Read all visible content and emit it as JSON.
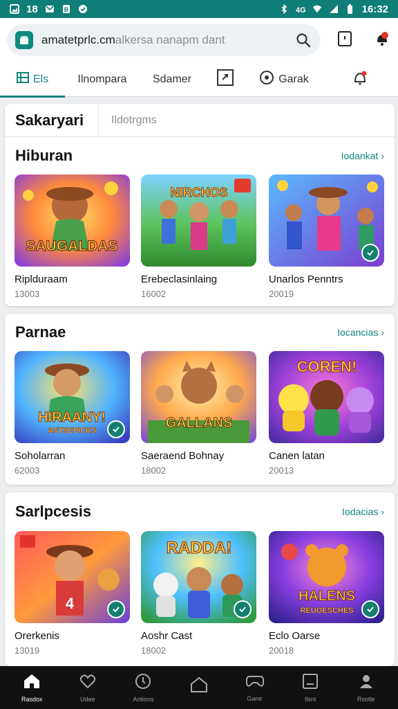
{
  "status_bar": {
    "time_left": "18",
    "time_right": "16:32"
  },
  "browser": {
    "url_main": "amatetprlc.cm",
    "url_rest": "alkersa nanapm dant"
  },
  "tabs": [
    {
      "label": "Els"
    },
    {
      "label": "Ilnompara"
    },
    {
      "label": "Sdamer"
    },
    {
      "label": ""
    },
    {
      "label": "Garak"
    },
    {
      "label": ""
    }
  ],
  "category_tabs": {
    "active": "Sakaryari",
    "inactive": "Ildotrgms"
  },
  "sections": [
    {
      "title": "Hiburan",
      "more": "Iodankat",
      "games": [
        {
          "name": "Riplduraam",
          "count": "13003",
          "art_text": "SAUGALDAS"
        },
        {
          "name": "Erebeclasinlaing",
          "count": "16002",
          "art_text": "NIRCHOS"
        },
        {
          "name": "Unarlos Penntrs",
          "count": "20019",
          "art_text": ""
        }
      ]
    },
    {
      "title": "Parnae",
      "more": "Iocancias",
      "games": [
        {
          "name": "Soholarran",
          "count": "62003",
          "art_text": "HIRAANY!",
          "art_sub": "ANTSEPICKS"
        },
        {
          "name": "Saeraend Bohnay",
          "count": "18002",
          "art_text": "GALLANS"
        },
        {
          "name": "Canen latan",
          "count": "20013",
          "art_text": "COREN!"
        }
      ]
    },
    {
      "title": "Sarlpcesis",
      "more": "Iodacias",
      "games": [
        {
          "name": "Orerkenis",
          "count": "13019",
          "art_text": ""
        },
        {
          "name": "Aoshr Cast",
          "count": "18002",
          "art_text": "RADDA!"
        },
        {
          "name": "Eclo Oarse",
          "count": "20018",
          "art_text": "HALENS",
          "art_sub": "REUOESCHES"
        }
      ]
    }
  ],
  "bottom_nav": [
    {
      "label": "Rasdox",
      "icon": "home-icon"
    },
    {
      "label": "Udee",
      "icon": "heart-icon"
    },
    {
      "label": "Aotions",
      "icon": "clock-icon"
    },
    {
      "label": "",
      "icon": "house-outline-icon"
    },
    {
      "label": "Gane",
      "icon": "gamepad-icon"
    },
    {
      "label": "Ilsnt",
      "icon": "tablet-icon"
    },
    {
      "label": "Rsotle",
      "icon": "profile-icon"
    }
  ],
  "colors": {
    "accent": "#13847e",
    "status_bar": "#0f7d78",
    "nav_bg": "#111111"
  }
}
